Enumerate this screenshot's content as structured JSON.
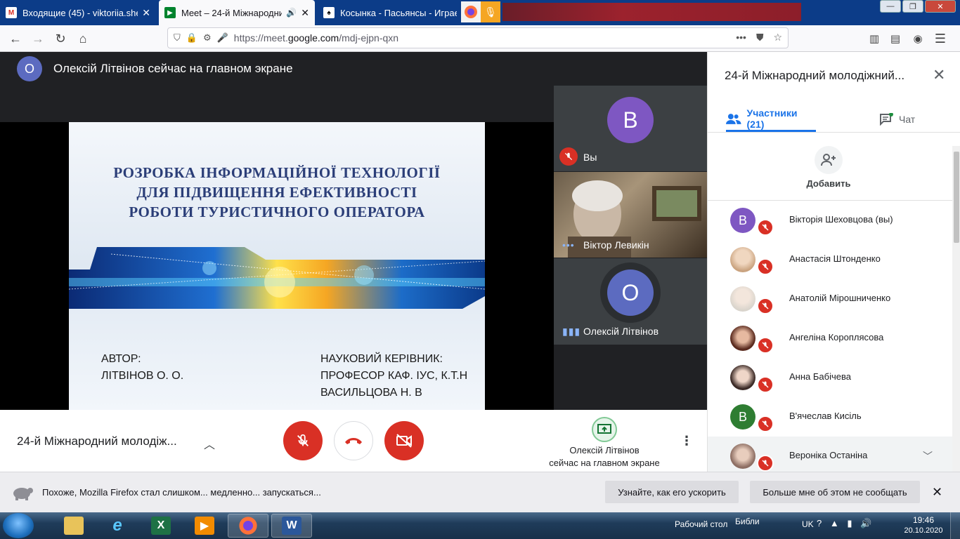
{
  "browser": {
    "tabs": [
      {
        "label": "Входящие (45) - viktoriia.shekh",
        "icon": "gmail-icon"
      },
      {
        "label": "Meet – 24-й Міжнародний",
        "icon": "meet-icon"
      },
      {
        "label": "Косынка - Пасьянсы - Играем",
        "icon": "solitaire-icon"
      }
    ],
    "url_prefix": "https://meet.",
    "url_host": "google.com",
    "url_path": "/mdj-ejpn-qxn",
    "url_more": "•••"
  },
  "meet": {
    "presenter_initial": "О",
    "presenter_banner": "Олексій Літвінов сейчас на главном экране",
    "slide": {
      "title_lines": [
        "РОЗРОБКА ІНФОРМАЦІЙНОЇ ТЕХНОЛОГІЇ",
        "ДЛЯ ПІДВИЩЕННЯ ЕФЕКТИВНОСТІ",
        "РОБОТИ ТУРИСТИЧНОГО ОПЕРАТОРА"
      ],
      "author_label": "АВТОР:",
      "author_name": "ЛІТВІНОВ О. О.",
      "supervisor_label": "НАУКОВИЙ КЕРІВНИК:",
      "supervisor_title": "ПРОФЕСОР КАФ. ІУС, К.Т.Н",
      "supervisor_name": "ВАСИЛЬЦОВА Н. В"
    },
    "tiles": [
      {
        "initial": "В",
        "name": "Вы",
        "color": "#7e57c2"
      },
      {
        "initial": "",
        "name": "Віктор Левикін",
        "color": ""
      },
      {
        "initial": "О",
        "name": "Олексій Літвінов",
        "color": "#5c6bc0"
      }
    ],
    "meeting_title": "24-й Міжнародний молодіж...",
    "present_line1": "Олексій Літвінов",
    "present_line2": "сейчас на главном экране"
  },
  "panel": {
    "title": "24-й Міжнародний молодіжний...",
    "tab_people": "Участники (21)",
    "tab_chat": "Чат",
    "add_label": "Добавить",
    "participants": [
      {
        "name": "Вікторія Шеховцова (вы)",
        "initial": "В",
        "color": "#7e57c2"
      },
      {
        "name": "Анастасія Штонденко",
        "initial": "",
        "color": "#c9a27e"
      },
      {
        "name": "Анатолій Мірошниченко",
        "initial": "",
        "color": "#d9d4cc"
      },
      {
        "name": "Ангеліна Короплясова",
        "initial": "",
        "color": "#5a2a1e"
      },
      {
        "name": "Анна Бабічева",
        "initial": "",
        "color": "#3b2a26"
      },
      {
        "name": "В'ячеслав Кисіль",
        "initial": "В",
        "color": "#2e7d32"
      },
      {
        "name": "Вероніка Останіна",
        "initial": "",
        "color": "#8d6e63"
      }
    ]
  },
  "notification": {
    "text": "Похоже, Mozilla Firefox стал слишком... медленно... запускаться...",
    "button1": "Узнайте, как его ускорить",
    "button2": "Больше мне об этом не сообщать"
  },
  "taskbar": {
    "desktop_label": "Рабочий стол",
    "libraries_label": "Библи",
    "lang": "UK",
    "time": "19:46",
    "date": "20.10.2020"
  }
}
